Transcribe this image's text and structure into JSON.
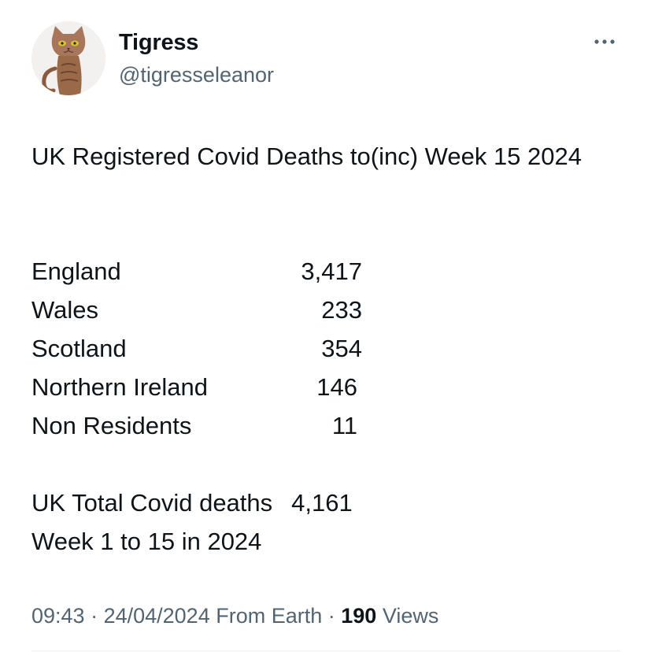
{
  "user": {
    "display_name": "Tigress",
    "handle": "@tigresseleanor",
    "avatar_icon": "cat-figurine-avatar"
  },
  "more_icon": "more-horizontal-icon",
  "tweet": {
    "headline": "UK Registered Covid Deaths to(inc) Week 15 2024",
    "rows": [
      {
        "region": "England",
        "count": "3,417"
      },
      {
        "region": "Wales",
        "count": "233"
      },
      {
        "region": "Scotland",
        "count": "354"
      },
      {
        "region": "Northern Ireland",
        "count": "146"
      },
      {
        "region": "Non Residents",
        "count": "11"
      }
    ],
    "total_label": "UK Total Covid deaths",
    "total_value": "4,161",
    "total_period": "Week 1 to 15 in 2024"
  },
  "meta": {
    "time": "09:43",
    "sep1": " · ",
    "date": "24/04/2024",
    "source": " From Earth",
    "sep2": " · ",
    "views_count": "190",
    "views_label": " Views"
  },
  "colors": {
    "text": "#0f1419",
    "secondary": "#536471",
    "divider": "#eff3f4"
  }
}
